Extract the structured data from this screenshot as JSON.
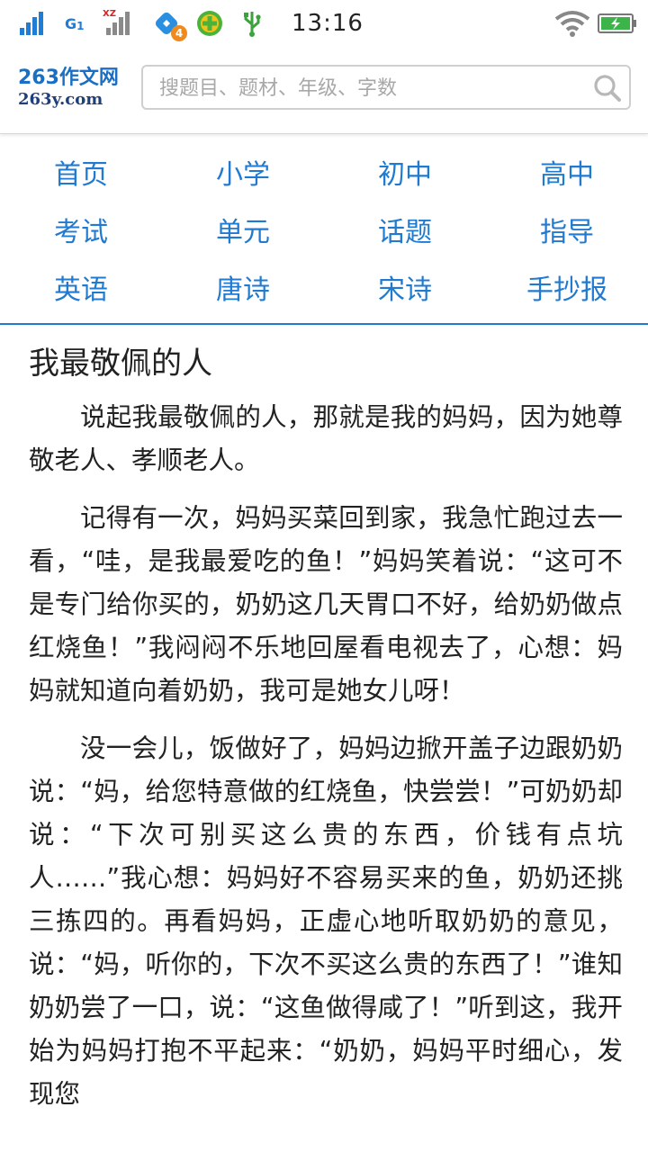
{
  "status_bar": {
    "network_label": "G",
    "network_sub": "1",
    "carrier2_label": "XZ",
    "notification_count": "4",
    "time": "13:16",
    "icons": [
      "signal-icon",
      "network-g1-icon",
      "signal-xz-icon",
      "app-notification-icon",
      "security-app-icon",
      "usb-icon",
      "wifi-icon",
      "battery-charging-icon"
    ]
  },
  "header": {
    "logo_top": "263作文网",
    "logo_bottom": "263y.com",
    "search_placeholder": "搜题目、题材、年级、字数"
  },
  "nav": {
    "items": [
      {
        "label": "首页"
      },
      {
        "label": "小学"
      },
      {
        "label": "初中"
      },
      {
        "label": "高中"
      },
      {
        "label": "考试"
      },
      {
        "label": "单元"
      },
      {
        "label": "话题"
      },
      {
        "label": "指导"
      },
      {
        "label": "英语"
      },
      {
        "label": "唐诗"
      },
      {
        "label": "宋诗"
      },
      {
        "label": "手抄报"
      }
    ]
  },
  "article": {
    "title": "我最敬佩的人",
    "paragraphs": [
      "说起我最敬佩的人，那就是我的妈妈，因为她尊敬老人、孝顺老人。",
      "记得有一次，妈妈买菜回到家，我急忙跑过去一看，“哇，是我最爱吃的鱼！”妈妈笑着说：“这可不是专门给你买的，奶奶这几天胃口不好，给奶奶做点红烧鱼！”我闷闷不乐地回屋看电视去了，心想：妈妈就知道向着奶奶，我可是她女儿呀！",
      "没一会儿，饭做好了，妈妈边掀开盖子边跟奶奶说：“妈，给您特意做的红烧鱼，快尝尝！”可奶奶却说：“下次可别买这么贵的东西，价钱有点坑人……”我心想：妈妈好不容易买来的鱼，奶奶还挑三拣四的。再看妈妈，正虚心地听取奶奶的意见，说：“妈，听你的，下次不买这么贵的东西了！”谁知奶奶尝了一口，说：“这鱼做得咸了！”听到这，我开始为妈妈打抱不平起来：“奶奶，妈妈平时细心，发现您"
    ]
  },
  "colors": {
    "accent": "#1f7ad0",
    "text": "#222222",
    "placeholder": "#a8a8a8"
  }
}
